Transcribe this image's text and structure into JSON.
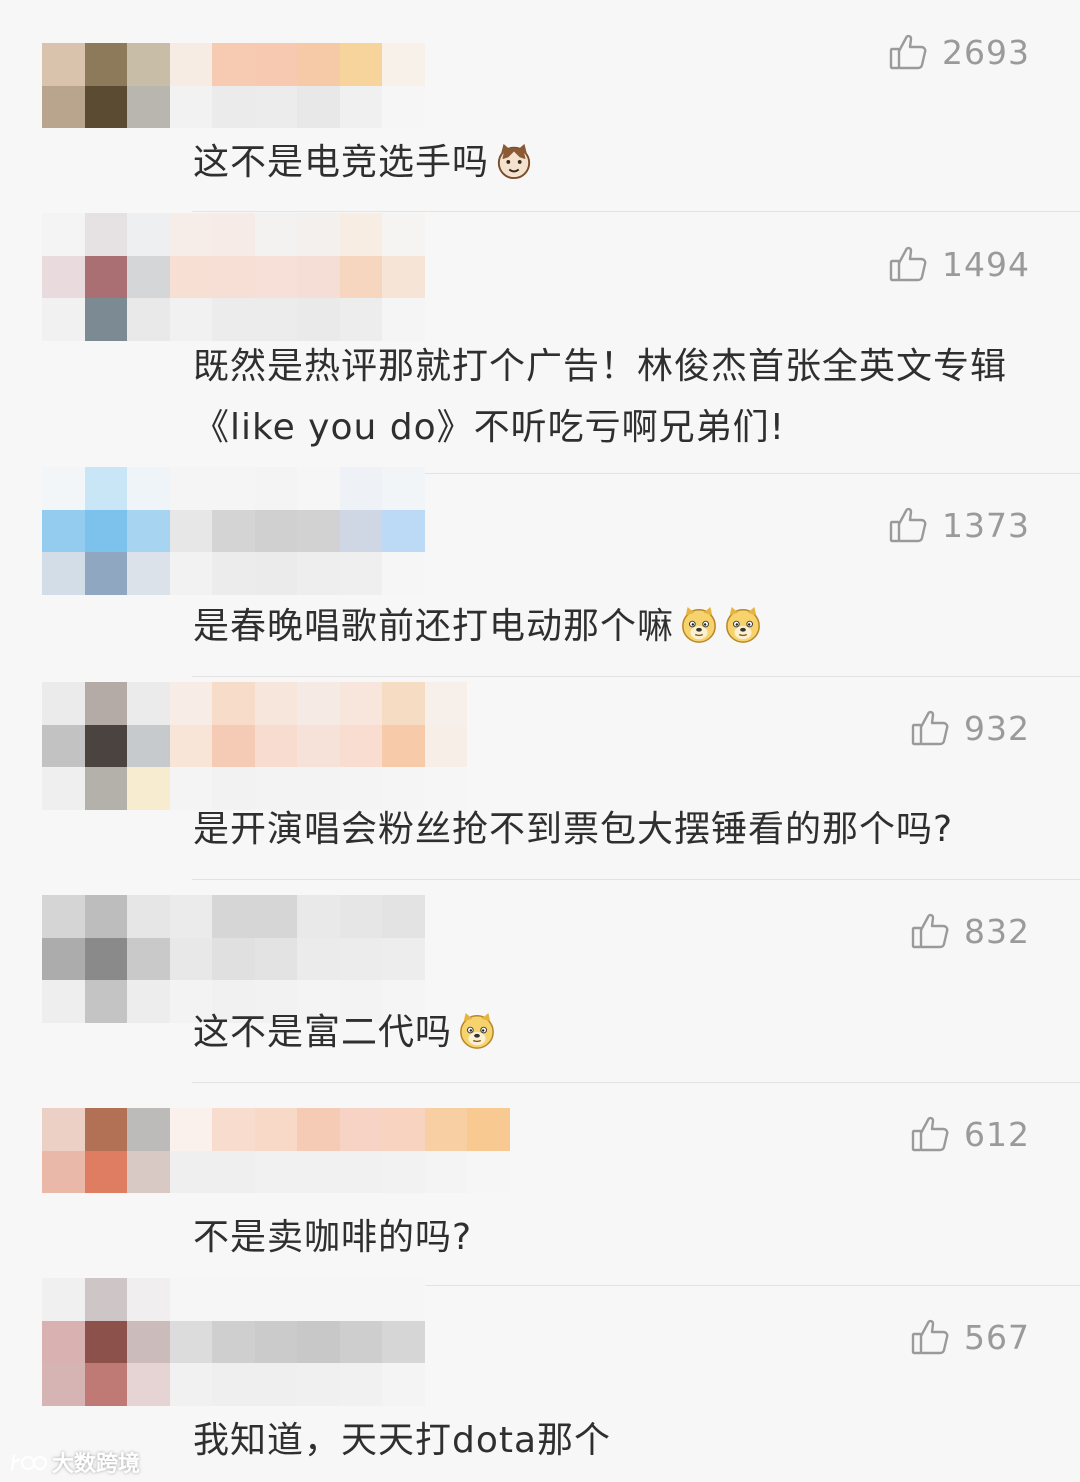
{
  "comments": [
    {
      "likes": "2693",
      "text": "这不是电竞选手吗",
      "emojis": [
        "cat-face"
      ],
      "mosaic": [
        [
          "#d9c3ad",
          "#8d7a5b",
          "#c8bea7",
          "#f7ece4",
          "#f7cbb2",
          "#f7c9b1",
          "#f7caa7",
          "#f7d49c",
          "#f7f1ea"
        ],
        [
          "#b9a58e",
          "#5c4b33",
          "#b8b6ae",
          "#f2f2f2",
          "#ebebeb",
          "#ececec",
          "#e8e8e8",
          "#f0f0f0",
          "#f6f6f6"
        ]
      ]
    },
    {
      "likes": "1494",
      "text": "既然是热评那就打个广告！林俊杰首张全英文专辑《like you do》不听吃亏啊兄弟们!",
      "emojis": [],
      "mosaic": [
        [
          "#f4f4f4",
          "#e6e2e3",
          "#eeeff1",
          "#f6ede9",
          "#f6ebe6",
          "#f4f2f0",
          "#f3f0ee",
          "#f7ede3",
          "#f6f4f2"
        ],
        [
          "#e9dadd",
          "#a96f72",
          "#d4d6d8",
          "#f7dfd3",
          "#f8dfd6",
          "#f7e0d7",
          "#f5ded5",
          "#f7d6bf",
          "#f6e4d7"
        ],
        [
          "#f1f1f1",
          "#7c8b93",
          "#e9e9e9",
          "#f1f1f1",
          "#ececec",
          "#ececec",
          "#eaeaea",
          "#ededed",
          "#f5f5f5"
        ]
      ]
    },
    {
      "likes": "1373",
      "text": "是春晚唱歌前还打电动那个嘛",
      "emojis": [
        "doge",
        "doge"
      ],
      "mosaic": [
        [
          "#f2f6f8",
          "#c8e6f6",
          "#eef4f7",
          "#f5f5f5",
          "#f5f5f5",
          "#f4f4f4",
          "#f6f6f6",
          "#eef1f6",
          "#f2f5f8"
        ],
        [
          "#94ccef",
          "#7cc2ec",
          "#a6d4f1",
          "#e7e7e7",
          "#d4d4d4",
          "#d0d0d0",
          "#d2d2d2",
          "#cfd7e4",
          "#bcd9f6"
        ],
        [
          "#d3dde7",
          "#8fa7c1",
          "#dbe2e9",
          "#f2f2f2",
          "#ececec",
          "#ebebeb",
          "#eeeeee",
          "#efefef",
          "#f6f6f6"
        ]
      ]
    },
    {
      "likes": "932",
      "text": "是开演唱会粉丝抢不到票包大摆锤看的那个吗?",
      "emojis": [],
      "mosaic": [
        [
          "#ebebeb",
          "#b5aba6",
          "#ebebeb",
          "#f8ece6",
          "#f8dcca",
          "#f7e6dc",
          "#f6ebe4",
          "#f8e6dc",
          "#f7dcc4",
          "#f6efea"
        ],
        [
          "#c2c2c2",
          "#4a4340",
          "#c7cacc",
          "#f9e4d8",
          "#f5cbb6",
          "#f7dccf",
          "#f6e2d8",
          "#f8ddd0",
          "#f7cba9",
          "#f7eee8"
        ],
        [
          "#efefef",
          "#b4b1aa",
          "#f7ebd0",
          "#f4f4f4",
          "#f2f2f2",
          "#f3f3f3",
          "#f3f3f3",
          "#f4f4f4",
          "#f5f5f5",
          "#f6f6f6"
        ]
      ]
    },
    {
      "likes": "832",
      "text": "这不是富二代吗",
      "emojis": [
        "doge"
      ],
      "mosaic": [
        [
          "#d5d5d5",
          "#bdbdbd",
          "#e6e6e6",
          "#ebebeb",
          "#d6d6d6",
          "#d6d6d6",
          "#e9e9e9",
          "#e6e6e6",
          "#e3e3e3"
        ],
        [
          "#acacac",
          "#8a8a8a",
          "#c9c9c9",
          "#e8e8e8",
          "#e0e0e0",
          "#e3e3e3",
          "#ebebeb",
          "#ececec",
          "#ededed"
        ],
        [
          "#eeeeee",
          "#c4c4c4",
          "#ededed",
          "#f3f3f3",
          "#f1f1f1",
          "#f2f2f2",
          "#f4f4f4",
          "#f3f3f3",
          "#f5f5f5"
        ]
      ]
    },
    {
      "likes": "612",
      "text": "不是卖咖啡的吗?",
      "emojis": [],
      "mosaic": [
        [
          "#ecd0c6",
          "#b27055",
          "#bdbbb9",
          "#faf1ec",
          "#f8dccd",
          "#f8d9c8",
          "#f6cbb5",
          "#f6d3c4",
          "#f7d3c0",
          "#f8cfa3",
          "#f8c990"
        ],
        [
          "#e9b8a8",
          "#df7d62",
          "#d9c9c5",
          "#efefef",
          "#efefef",
          "#f1f1f1",
          "#f1f1f1",
          "#f1f1f1",
          "#f2f2f2",
          "#f4f4f4",
          "#f6f6f6"
        ]
      ]
    },
    {
      "likes": "567",
      "text": "我知道，天天打dota那个",
      "emojis": [],
      "mosaic": [
        [
          "#f0f0f0",
          "#cec5c6",
          "#f0eeee",
          "#f6f6f6",
          "#f6f6f6",
          "#f6f6f6",
          "#f6f6f6",
          "#f6f6f6",
          "#f6f6f6"
        ],
        [
          "#d9b1b1",
          "#8d514c",
          "#cbbcbb",
          "#dcdcdc",
          "#cfcfcf",
          "#cbcbcb",
          "#c8c8c8",
          "#cecece",
          "#d6d6d6"
        ],
        [
          "#d6b4b3",
          "#c07a76",
          "#e6d3d4",
          "#f1f1f1",
          "#efefef",
          "#efefef",
          "#f0f0f0",
          "#f1f1f1",
          "#f4f4f4"
        ]
      ]
    }
  ],
  "watermark": {
    "label": "大数跨境"
  },
  "colors": {
    "background": "#f7f7f7",
    "text": "#2f2f2f",
    "likes": "#9a9a9a",
    "divider": "#e3e3e3"
  }
}
